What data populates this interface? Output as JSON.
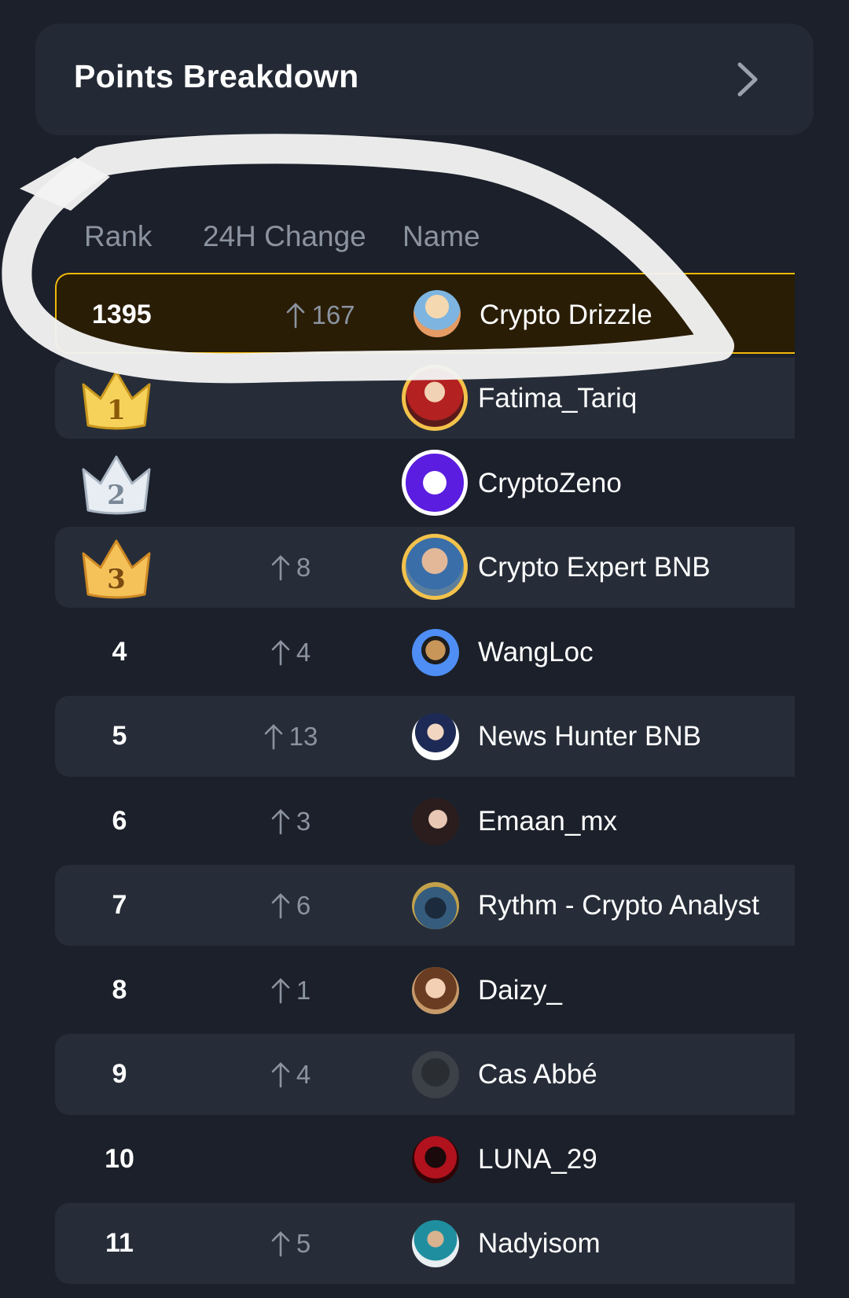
{
  "header_card": {
    "title": "Points Breakdown",
    "chevron_icon": "chevron-right-icon"
  },
  "table": {
    "columns": {
      "rank": "Rank",
      "change": "24H Change",
      "name": "Name"
    },
    "current_user": {
      "rank": "1395",
      "change": "167",
      "name": "Crypto Drizzle"
    },
    "rows": [
      {
        "rank": "1",
        "crown": "gold",
        "change": "",
        "name": "Fatima_Tariq"
      },
      {
        "rank": "2",
        "crown": "silver",
        "change": "",
        "name": "CryptoZeno"
      },
      {
        "rank": "3",
        "crown": "bronze",
        "change": "8",
        "name": "Crypto Expert BNB"
      },
      {
        "rank": "4",
        "change": "4",
        "name": "WangLoc"
      },
      {
        "rank": "5",
        "change": "13",
        "name": "News Hunter BNB"
      },
      {
        "rank": "6",
        "change": "3",
        "name": "Emaan_mx"
      },
      {
        "rank": "7",
        "change": "6",
        "name": "Rythm - Crypto Analyst"
      },
      {
        "rank": "8",
        "change": "1",
        "name": "Daizy_"
      },
      {
        "rank": "9",
        "change": "4",
        "name": "Cas Abbé"
      },
      {
        "rank": "10",
        "change": "",
        "name": "LUNA_29"
      },
      {
        "rank": "11",
        "change": "5",
        "name": "Nadyisom"
      }
    ]
  },
  "colors": {
    "accent": "#f0b90b",
    "background": "#1b202a",
    "muted": "#8b93a0"
  }
}
